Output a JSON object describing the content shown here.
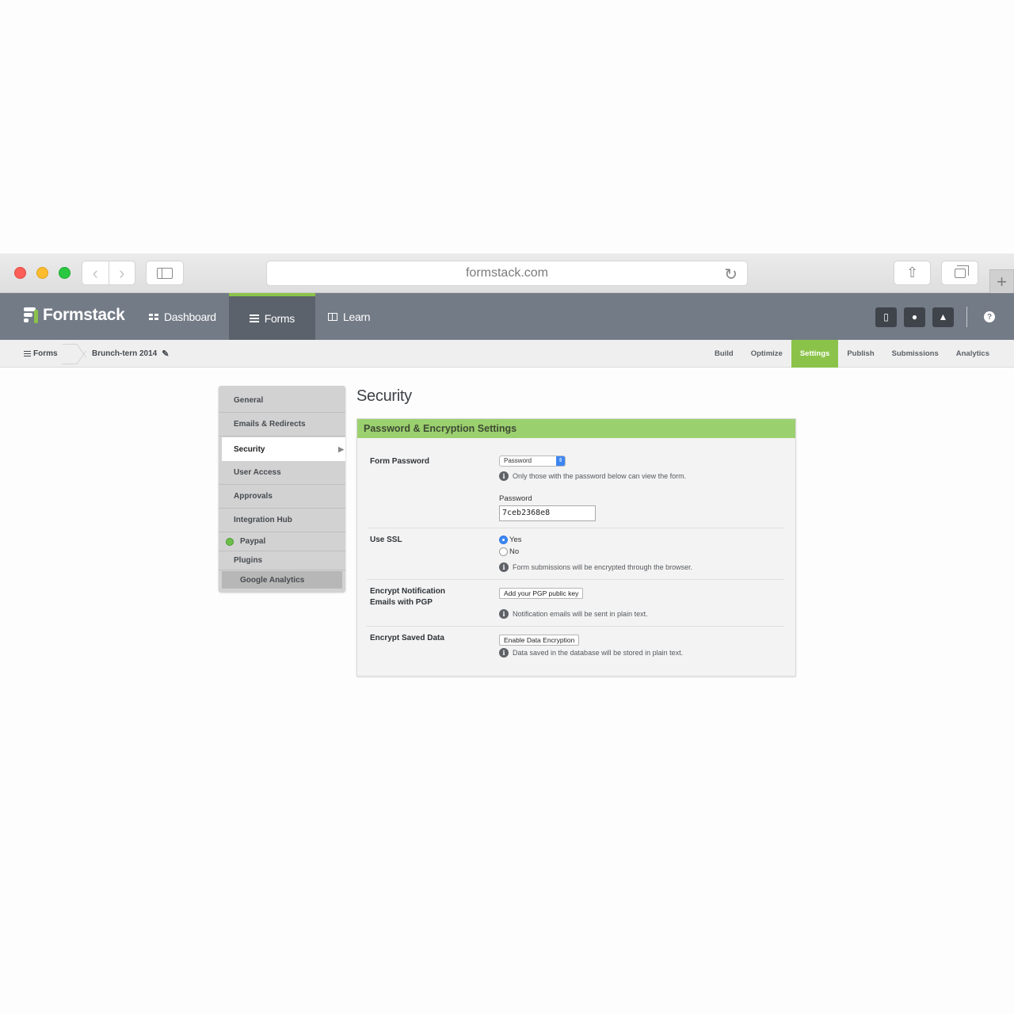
{
  "browser": {
    "url": "formstack.com",
    "icons": {
      "back": "chevron-left-icon",
      "forward": "chevron-right-icon",
      "sidebar": "sidebar-icon",
      "reload": "reload-icon",
      "share": "share-icon",
      "tabs": "tabs-icon",
      "new_tab": "plus-icon"
    }
  },
  "app": {
    "logo_text": "Formstack",
    "nav": [
      {
        "label": "Dashboard",
        "icon": "dashboard-icon"
      },
      {
        "label": "Forms",
        "icon": "list-icon",
        "active": true
      },
      {
        "label": "Learn",
        "icon": "book-icon"
      }
    ],
    "header_icons": [
      "book-icon",
      "user-icon",
      "bell-icon",
      "help-icon"
    ],
    "accent_color": "#8bc34a"
  },
  "breadcrumb": {
    "root": "Forms",
    "form_name": "Brunch-tern 2014"
  },
  "form_tabs": [
    "Build",
    "Optimize",
    "Settings",
    "Publish",
    "Submissions",
    "Analytics"
  ],
  "active_form_tab": "Settings",
  "settings_menu": {
    "items": [
      "General",
      "Emails & Redirects",
      "Security",
      "User Access",
      "Approvals",
      "Integration Hub",
      "Paypal",
      "Plugins",
      "Google Analytics"
    ],
    "active": "Security"
  },
  "page": {
    "title": "Security",
    "panel_title": "Password & Encryption Settings",
    "form_password": {
      "label": "Form Password",
      "select_value": "Password",
      "help": "Only those with the password below can view the form.",
      "password_label": "Password",
      "password_value": "7ceb2368e8"
    },
    "use_ssl": {
      "label": "Use SSL",
      "options": [
        "Yes",
        "No"
      ],
      "selected": "Yes",
      "help": "Form submissions will be encrypted through the browser."
    },
    "encrypt_emails": {
      "label_line1": "Encrypt Notification",
      "label_line2": "Emails with PGP",
      "button": "Add your PGP public key",
      "help": "Notification emails will be sent in plain text."
    },
    "encrypt_data": {
      "label": "Encrypt Saved Data",
      "button": "Enable Data Encryption",
      "help": "Data saved in the database will be stored in plain text."
    }
  }
}
